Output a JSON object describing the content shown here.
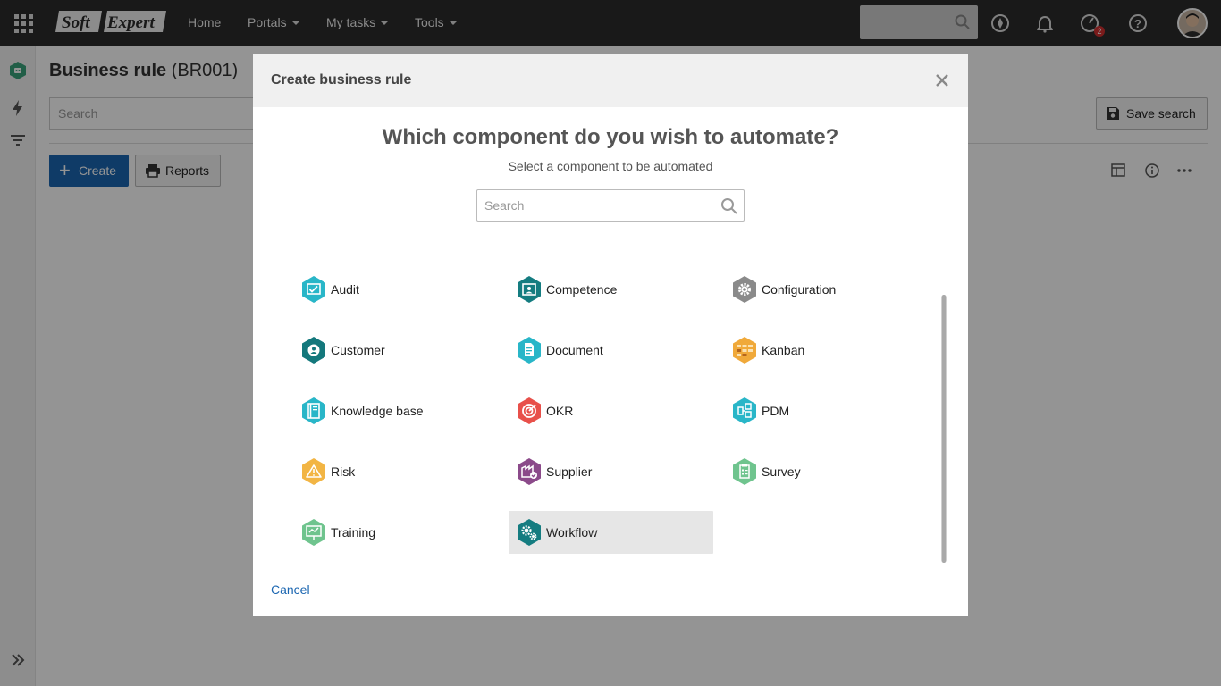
{
  "topbar": {
    "logo_text_1": "Soft",
    "logo_text_2": "Expert",
    "nav": [
      {
        "label": "Home",
        "dropdown": false
      },
      {
        "label": "Portals",
        "dropdown": true
      },
      {
        "label": "My tasks",
        "dropdown": true
      },
      {
        "label": "Tools",
        "dropdown": true
      }
    ],
    "notification_badge": "2"
  },
  "page": {
    "title": "Business rule",
    "code": "(BR001)",
    "search_placeholder": "Search",
    "save_search_label": "Save search",
    "create_label": "Create",
    "reports_label": "Reports"
  },
  "modal": {
    "title": "Create business rule",
    "question": "Which component do you wish to automate?",
    "subtitle": "Select a component to be automated",
    "search_placeholder": "Search",
    "cancel_label": "Cancel",
    "components": [
      {
        "label": "Audit",
        "color": "#29b6c8",
        "icon": "audit-icon",
        "selected": false
      },
      {
        "label": "Competence",
        "color": "#147c80",
        "icon": "competence-icon",
        "selected": false
      },
      {
        "label": "Configuration",
        "color": "#8a8a8a",
        "icon": "gear-icon",
        "selected": false
      },
      {
        "label": "Customer",
        "color": "#14787c",
        "icon": "customer-icon",
        "selected": false
      },
      {
        "label": "Document",
        "color": "#29b6c8",
        "icon": "document-icon",
        "selected": false
      },
      {
        "label": "Kanban",
        "color": "#f0a93a",
        "icon": "kanban-icon",
        "selected": false
      },
      {
        "label": "Knowledge base",
        "color": "#29b6c8",
        "icon": "book-icon",
        "selected": false
      },
      {
        "label": "OKR",
        "color": "#e8504a",
        "icon": "target-icon",
        "selected": false
      },
      {
        "label": "PDM",
        "color": "#29b6c8",
        "icon": "pdm-icon",
        "selected": false
      },
      {
        "label": "Risk",
        "color": "#f2b544",
        "icon": "warning-icon",
        "selected": false
      },
      {
        "label": "Supplier",
        "color": "#8b4a8a",
        "icon": "supplier-icon",
        "selected": false
      },
      {
        "label": "Survey",
        "color": "#6fc48e",
        "icon": "survey-icon",
        "selected": false
      },
      {
        "label": "Training",
        "color": "#6fc48e",
        "icon": "training-icon",
        "selected": false
      },
      {
        "label": "Workflow",
        "color": "#147c80",
        "icon": "workflow-icon",
        "selected": true
      }
    ]
  }
}
